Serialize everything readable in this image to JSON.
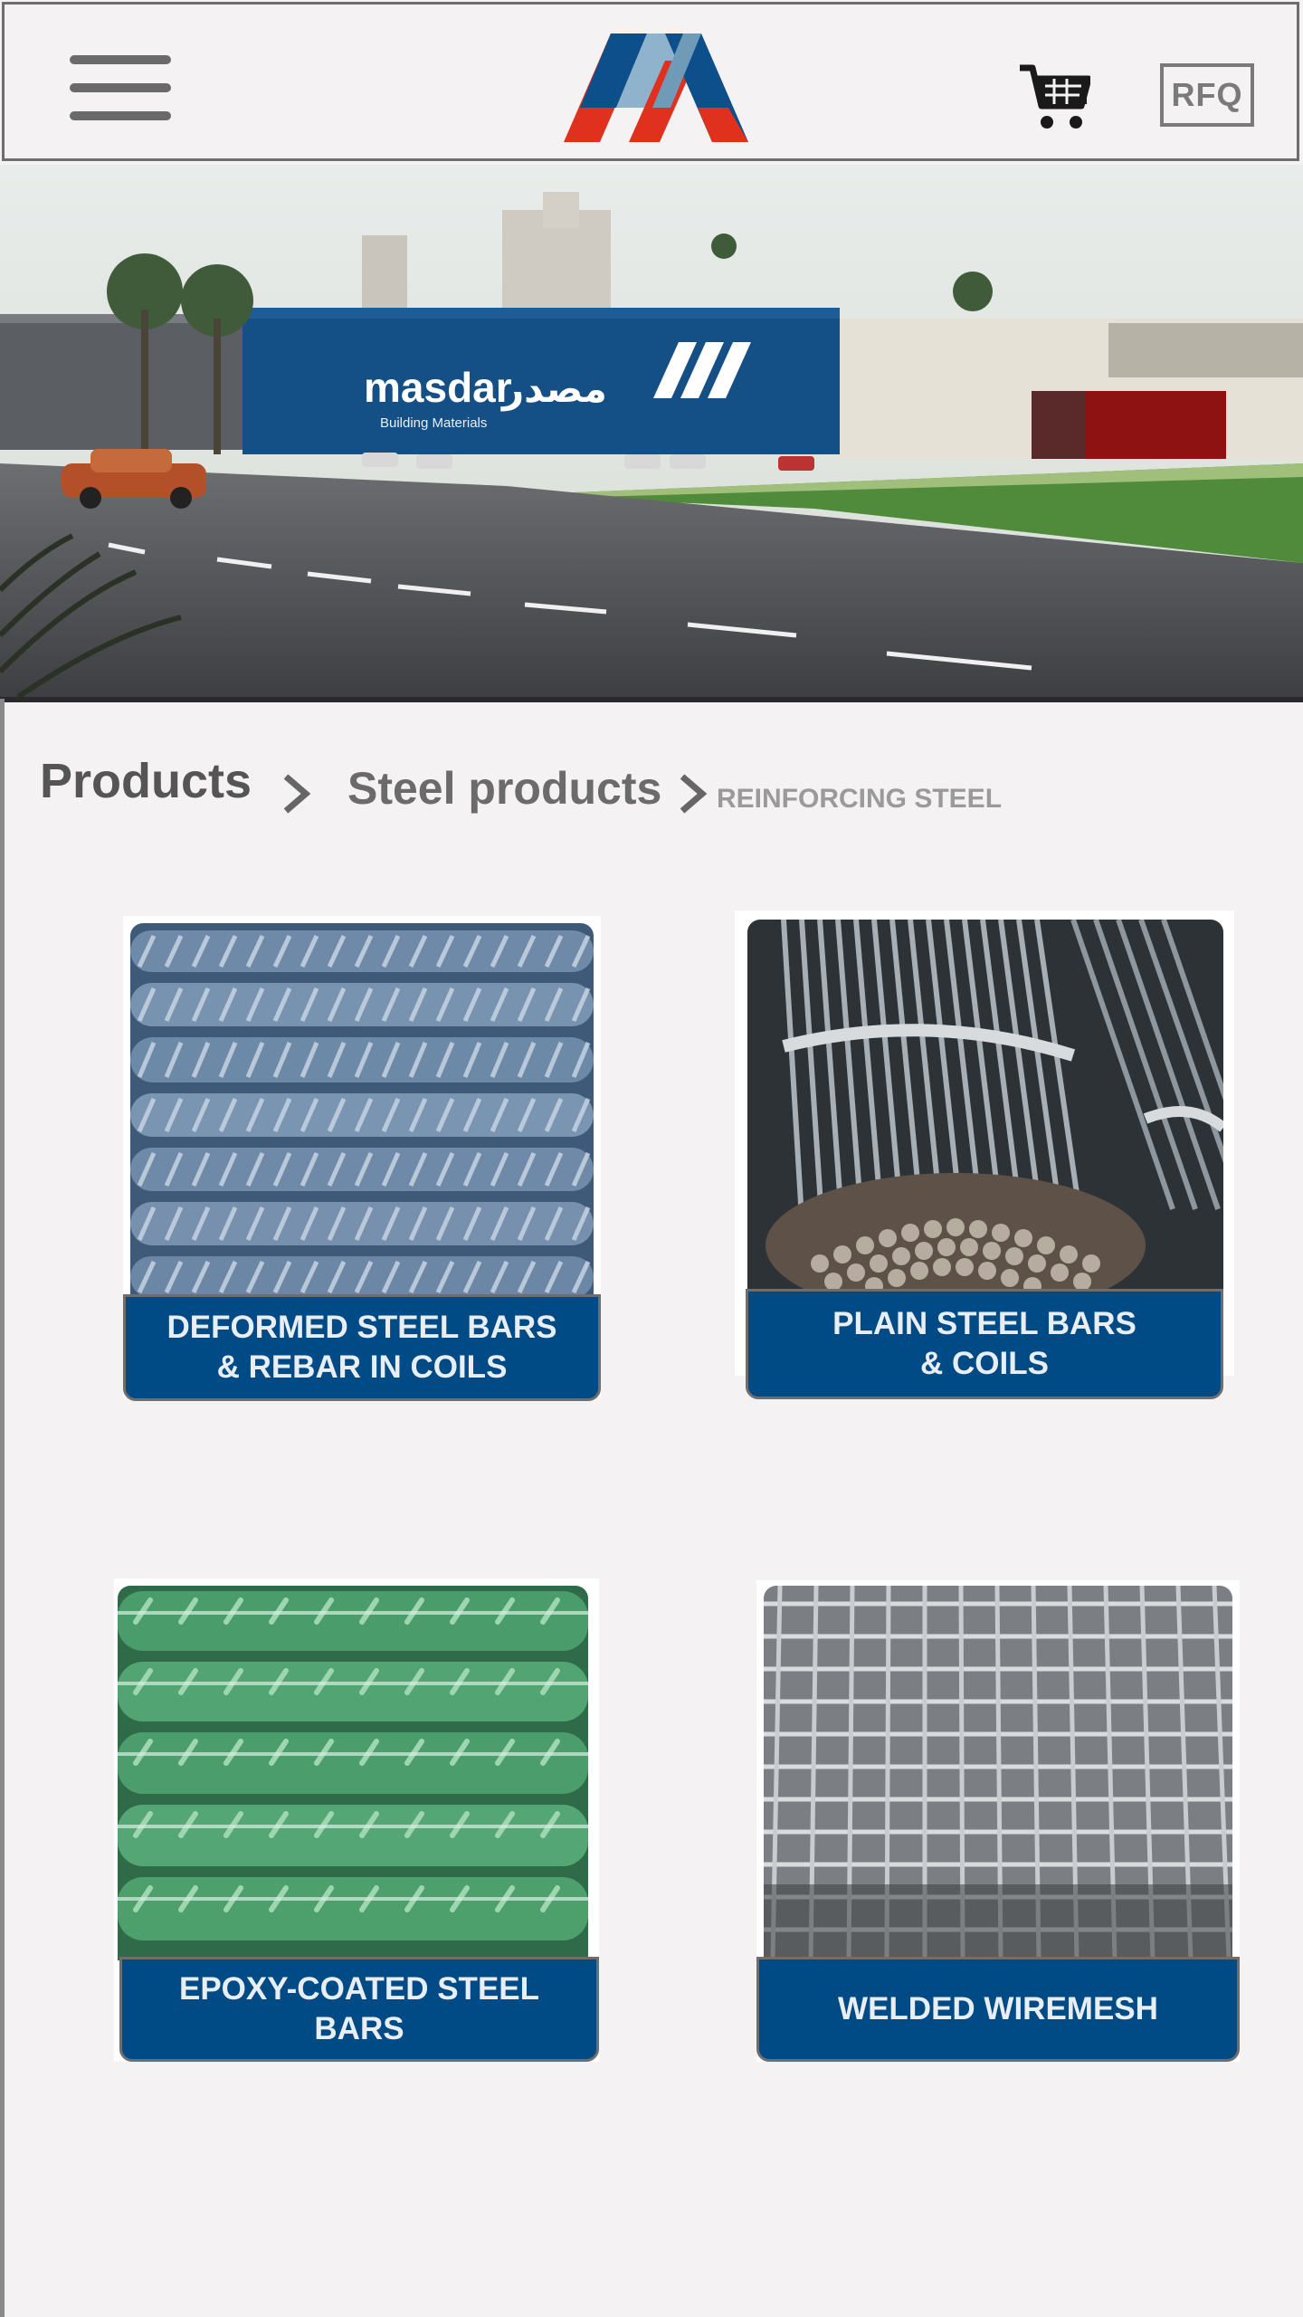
{
  "header": {
    "menu_icon": "hamburger-menu-icon",
    "logo_icon": "masdar-logo-icon",
    "cart_icon": "shopping-cart-icon",
    "rfq_label": "RFQ"
  },
  "hero": {
    "sign_text": "masdar",
    "sign_arabic": "مصدر",
    "sign_sub": "Building Materials"
  },
  "breadcrumb": {
    "products": "Products",
    "steel": "Steel products",
    "current": "REINFORCING STEEL"
  },
  "products": [
    {
      "label": "DEFORMED STEEL BARS & REBAR IN COILS"
    },
    {
      "label": "PLAIN STEEL BARS & COILS"
    },
    {
      "label": "EPOXY-COATED STEEL BARS"
    },
    {
      "label": "WELDED WIREMESH"
    }
  ],
  "colors": {
    "brand_blue": "#004a85",
    "brand_red": "#e0311e",
    "brand_light": "#8fb3cc"
  }
}
